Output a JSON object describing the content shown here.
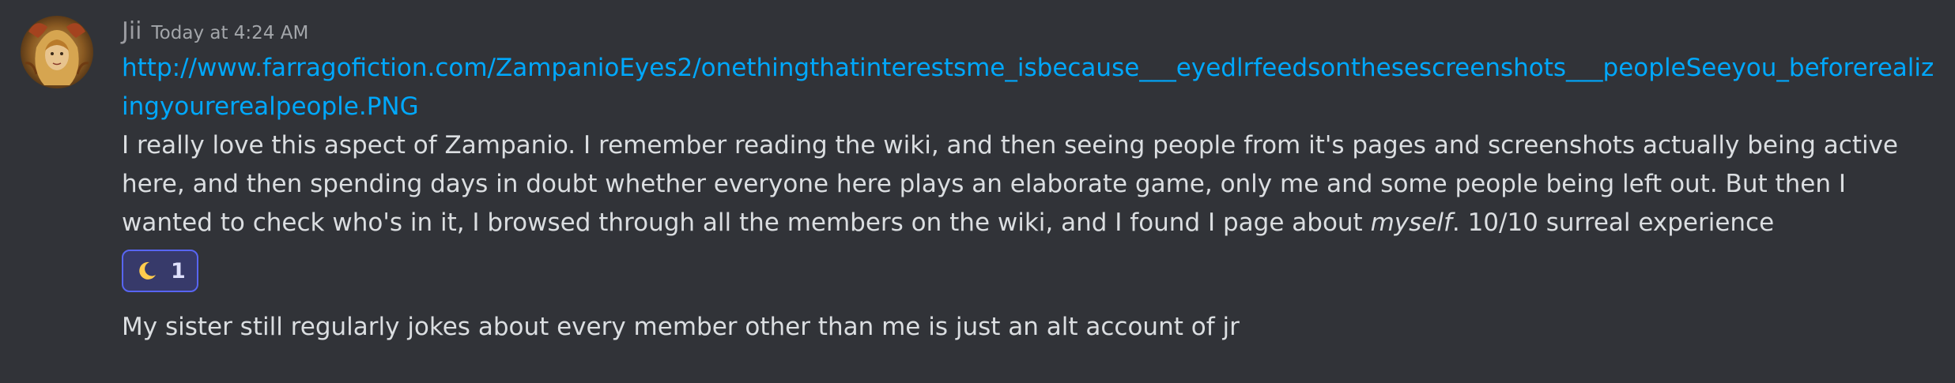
{
  "message": {
    "author": "Jii",
    "timestamp": "Today at 4:24 AM",
    "avatar_icon": "fantasy-portrait-avatar",
    "link": "http://www.farragofiction.com/ZampanioEyes2/onethingthatinterestsme_isbecause___eyedlrfeedsonthesescreenshots___peopleSeeyou_beforerealizingyourerealpeople.PNG",
    "text_before_em": "I really love this aspect of Zampanio. I remember reading the wiki, and then seeing people from it's pages and screenshots actually being active here, and then spending days in doubt whether everyone here plays an elaborate game, only me and some people being left out. But then I wanted to check who's in it, I browsed through all the members on the wiki, and I found I page about ",
    "text_em": "myself",
    "text_after_em": ". 10/10 surreal experience",
    "reaction": {
      "emoji_icon": "crescent-moon-icon",
      "count": "1",
      "accent_color": "#5865f2"
    }
  },
  "second_message": {
    "text": "My sister still regularly jokes about every member other than me is just an alt account of jr"
  },
  "colors": {
    "background": "#313338",
    "link": "#00a8fc",
    "text": "#dbdee1",
    "username": "#9b9ca1"
  }
}
